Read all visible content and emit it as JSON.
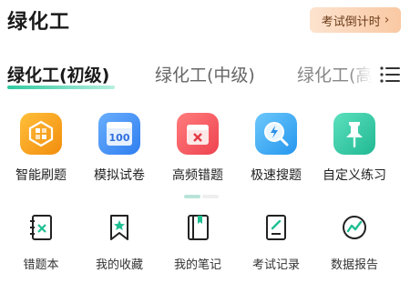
{
  "header": {
    "title": "绿化工",
    "countdown_label": "考试倒计时",
    "countdown_icon": "chevron-right-icon"
  },
  "tabs": [
    {
      "label": "绿化工(初级)",
      "active": true
    },
    {
      "label": "绿化工(中级)",
      "active": false
    },
    {
      "label": "绿化工(高级)",
      "active": false
    }
  ],
  "features": [
    {
      "label": "智能刷题",
      "icon": "smart-practice-icon",
      "color": "#f7a11a"
    },
    {
      "label": "模拟试卷",
      "icon": "mock-exam-icon",
      "color": "#3f8df5",
      "badge": "100"
    },
    {
      "label": "高频错题",
      "icon": "frequent-errors-icon",
      "color": "#f0535a"
    },
    {
      "label": "极速搜题",
      "icon": "quick-search-icon",
      "color": "#2ea6f0"
    },
    {
      "label": "自定义练习",
      "icon": "custom-practice-icon",
      "color": "#2ec8a4"
    }
  ],
  "tools": [
    {
      "label": "错题本",
      "icon": "error-book-icon"
    },
    {
      "label": "我的收藏",
      "icon": "bookmark-icon"
    },
    {
      "label": "我的笔记",
      "icon": "notebook-icon"
    },
    {
      "label": "考试记录",
      "icon": "exam-record-icon"
    },
    {
      "label": "数据报告",
      "icon": "data-report-icon"
    }
  ],
  "pager": {
    "pages": 2,
    "current": 1
  },
  "colors": {
    "accent": "#2fc9a0",
    "countdown_bg": "#fbd3b3"
  }
}
